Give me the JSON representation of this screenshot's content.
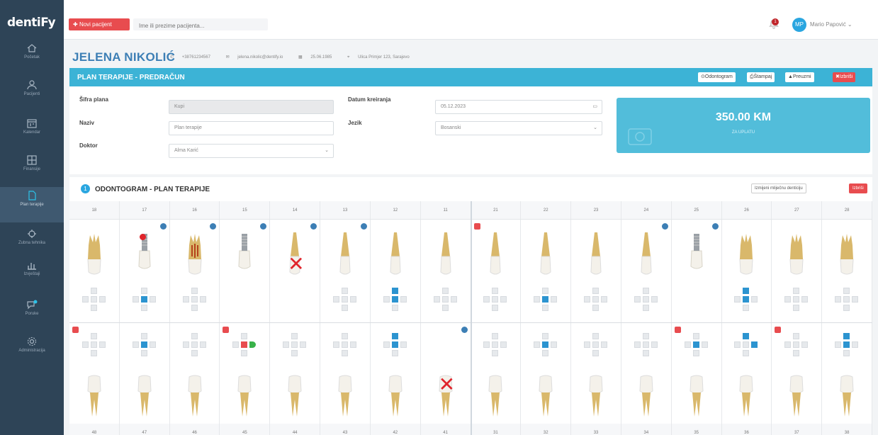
{
  "app": {
    "logo": "dentiFy"
  },
  "topbar": {
    "new_patient_label": "Novi pacijent",
    "search_placeholder": "Ime ili prezime pacijenta...",
    "notification_count": "1",
    "user_initials": "MP",
    "user_name": "Mario Papović"
  },
  "sidebar": {
    "items": [
      {
        "label": "Početak",
        "icon": "home-icon"
      },
      {
        "label": "Pacijenti",
        "icon": "user-icon"
      },
      {
        "label": "Kalendar",
        "icon": "calendar-icon"
      },
      {
        "label": "Finansije",
        "icon": "finance-icon"
      },
      {
        "label": "Plan terapije",
        "icon": "document-icon"
      },
      {
        "label": "Zubna tehnika",
        "icon": "tooth-tech-icon"
      },
      {
        "label": "Izvještaji",
        "icon": "chart-icon"
      },
      {
        "label": "Poruke",
        "icon": "chat-icon"
      },
      {
        "label": "Administracija",
        "icon": "gear-icon"
      }
    ],
    "active_index": 4
  },
  "patient": {
    "name": "JELENA NIKOLIĆ",
    "phone": "+38761234567",
    "email": "jelena.nikolic@dentify.io",
    "dob": "25.06.1985",
    "address": "Ulica Primjer 123, Sarajevo"
  },
  "plan": {
    "title": "PLAN TERAPIJE - PREDRAČUN",
    "buttons": {
      "odontogram": "Odontogram",
      "print": "Štampaj",
      "download": "Preuzmi",
      "delete": "Izbriši"
    },
    "fields": {
      "sifra_label": "Šifra plana",
      "sifra_value": "Kupi",
      "naziv_label": "Naziv",
      "naziv_value": "Plan terapije",
      "doktor_label": "Doktor",
      "doktor_value": "Alma Karić",
      "datum_label": "Datum kreiranja",
      "datum_value": "05.12.2023",
      "jezik_label": "Jezik",
      "jezik_value": "Bosanski"
    },
    "total_amount": "350.00 KM",
    "total_label": "ZA UPLATU"
  },
  "odontogram": {
    "number": "1",
    "title": "ODONTOGRAM - PLAN TERAPIJE",
    "btn_change": "Izmijeni mliječnu denticiju",
    "btn_delete": "Izbriši",
    "upper_numbers": [
      "18",
      "17",
      "16",
      "15",
      "14",
      "13",
      "12",
      "11",
      "21",
      "22",
      "23",
      "24",
      "25",
      "26",
      "27",
      "28"
    ],
    "lower_numbers": [
      "48",
      "47",
      "46",
      "45",
      "44",
      "43",
      "42",
      "41",
      "31",
      "32",
      "33",
      "34",
      "35",
      "36",
      "37",
      "38"
    ]
  },
  "colors": {
    "sidebar": "#2e4457",
    "accent": "#3cb3d6",
    "danger": "#e84c4f",
    "selected": "#2c94d0"
  }
}
